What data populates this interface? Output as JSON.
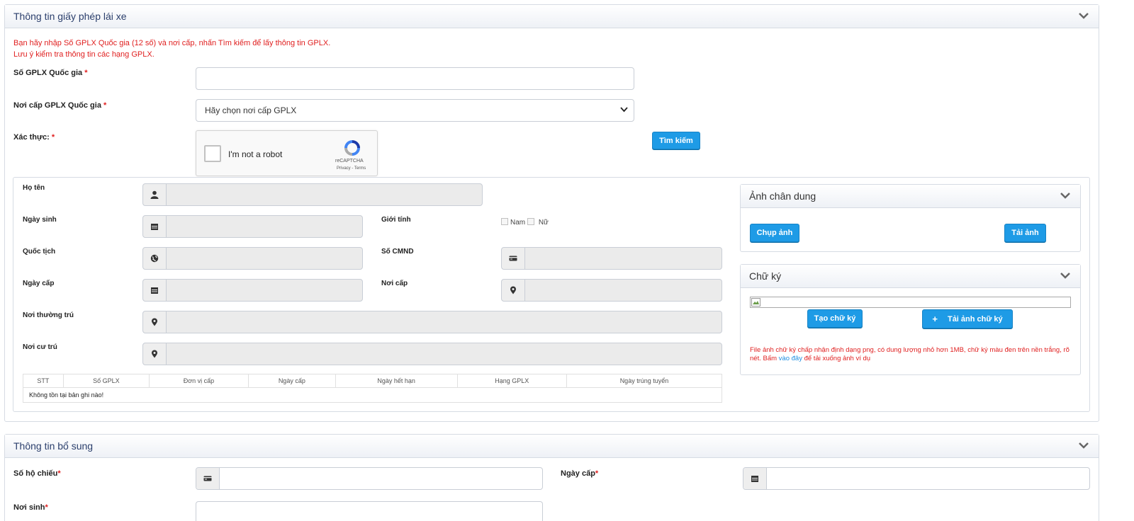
{
  "license_panel": {
    "title": "Thông tin giấy phép lái xe",
    "notice_line1": "Bạn hãy nhập Số GPLX Quốc gia (12 số) và nơi cấp, nhấn Tìm kiếm để lấy thông tin GPLX.",
    "notice_line2": "Lưu ý kiểm tra thông tin các hạng GPLX.",
    "fields": {
      "license_number_label": "Số GPLX Quốc gia",
      "issuer_label": "Nơi cấp GPLX Quốc gia",
      "issuer_selected": "Hãy chọn nơi cấp GPLX",
      "verify_label": "Xác thực:"
    },
    "required_mark": "*",
    "captcha": {
      "label": "I'm not a robot",
      "brand": "reCAPTCHA",
      "terms": "Privacy - Terms"
    },
    "search_button": "Tìm kiếm"
  },
  "details": {
    "full_name_label": "Họ tên",
    "dob_label": "Ngày sinh",
    "gender_label": "Giới tính",
    "gender_male": "Nam",
    "gender_female": "Nữ",
    "nationality_label": "Quốc tịch",
    "id_number_label": "Số CMND",
    "issue_date_label": "Ngày cấp",
    "issue_place_label": "Nơi cấp",
    "permanent_address_label": "Nơi thường trú",
    "residence_label": "Nơi cư trú"
  },
  "license_table": {
    "columns": [
      "STT",
      "Số GPLX",
      "Đơn vị cấp",
      "Ngày cấp",
      "Ngày hết hạn",
      "Hạng GPLX",
      "Ngày trúng tuyển"
    ],
    "empty_message": "Không tồn tại bản ghi nào!"
  },
  "portrait_panel": {
    "title": "Ảnh chân dung",
    "capture_button": "Chụp ảnh",
    "upload_button": "Tải ảnh"
  },
  "signature_panel": {
    "title": "Chữ ký",
    "create_button": "Tạo chữ ký",
    "upload_icon": "+",
    "upload_button": "Tải ảnh chữ ký",
    "note_before_link": "File ảnh chữ ký chấp nhận định dạng png, có dung lượng nhỏ hơn 1MB, chữ ký màu đen trên nền trắng, rõ nét. Bấm ",
    "note_link": "vào đây",
    "note_after_link": " để tải xuống ảnh ví dụ"
  },
  "extra_panel": {
    "title": "Thông tin bổ sung",
    "passport_label": "Số hộ chiếu",
    "passport_date_label": "Ngày cấp",
    "birthplace_label": "Nơi sinh"
  },
  "icons": {
    "user": "user-icon",
    "calendar": "calendar-icon",
    "globe": "globe-icon",
    "id_card": "id-card-icon",
    "location": "map-marker-icon",
    "chevron": "chevron-down-icon"
  },
  "colors": {
    "accent": "#1e9be6",
    "panel_title": "#2b3f6c",
    "warning": "#e02020"
  }
}
